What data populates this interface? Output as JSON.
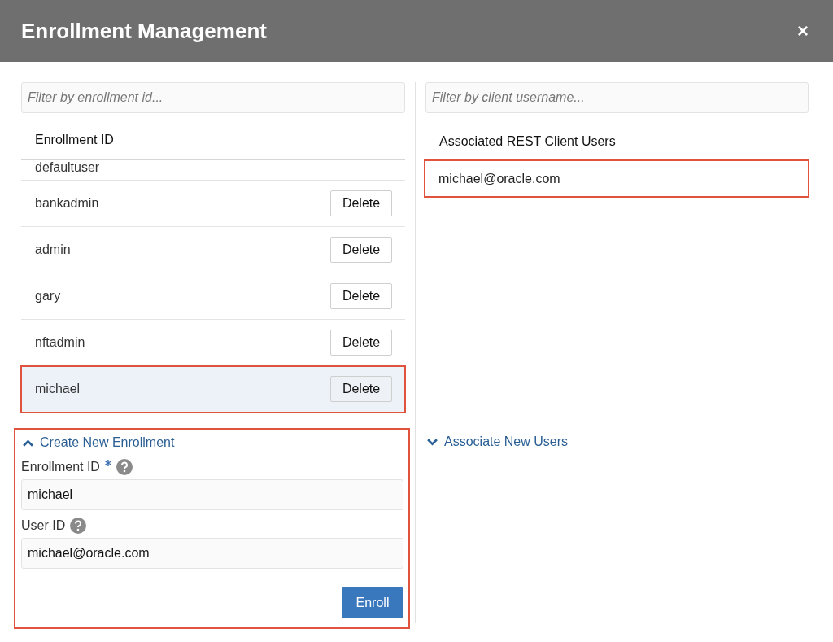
{
  "window": {
    "title": "Enrollment Management",
    "close": "×"
  },
  "enrollments": {
    "filter_placeholder": "Filter by enrollment id...",
    "column": "Enrollment ID",
    "rows": [
      {
        "id": "defaultuser",
        "selected": false,
        "highlighted": false
      },
      {
        "id": "bankadmin",
        "action": "Delete",
        "selected": false,
        "highlighted": false
      },
      {
        "id": "admin",
        "action": "Delete",
        "selected": false,
        "highlighted": false
      },
      {
        "id": "gary",
        "action": "Delete",
        "selected": false,
        "highlighted": false
      },
      {
        "id": "nftadmin",
        "action": "Delete",
        "selected": false,
        "highlighted": false
      },
      {
        "id": "michael",
        "action": "Delete",
        "selected": true,
        "highlighted": true
      }
    ]
  },
  "create_section": {
    "title": "Create New Enrollment",
    "expanded": true,
    "highlighted": true,
    "fields": [
      {
        "label": "Enrollment ID",
        "required": true,
        "value": "michael"
      },
      {
        "label": "User ID",
        "required": false,
        "value": "michael@oracle.com"
      }
    ],
    "button": "Enroll"
  },
  "clients": {
    "filter_placeholder": "Filter by client username...",
    "column": "Associated REST Client Users",
    "rows": [
      {
        "user": "michael@oracle.com",
        "highlighted": true
      }
    ]
  },
  "associate_section": {
    "title": "Associate New Users",
    "expanded": false
  }
}
